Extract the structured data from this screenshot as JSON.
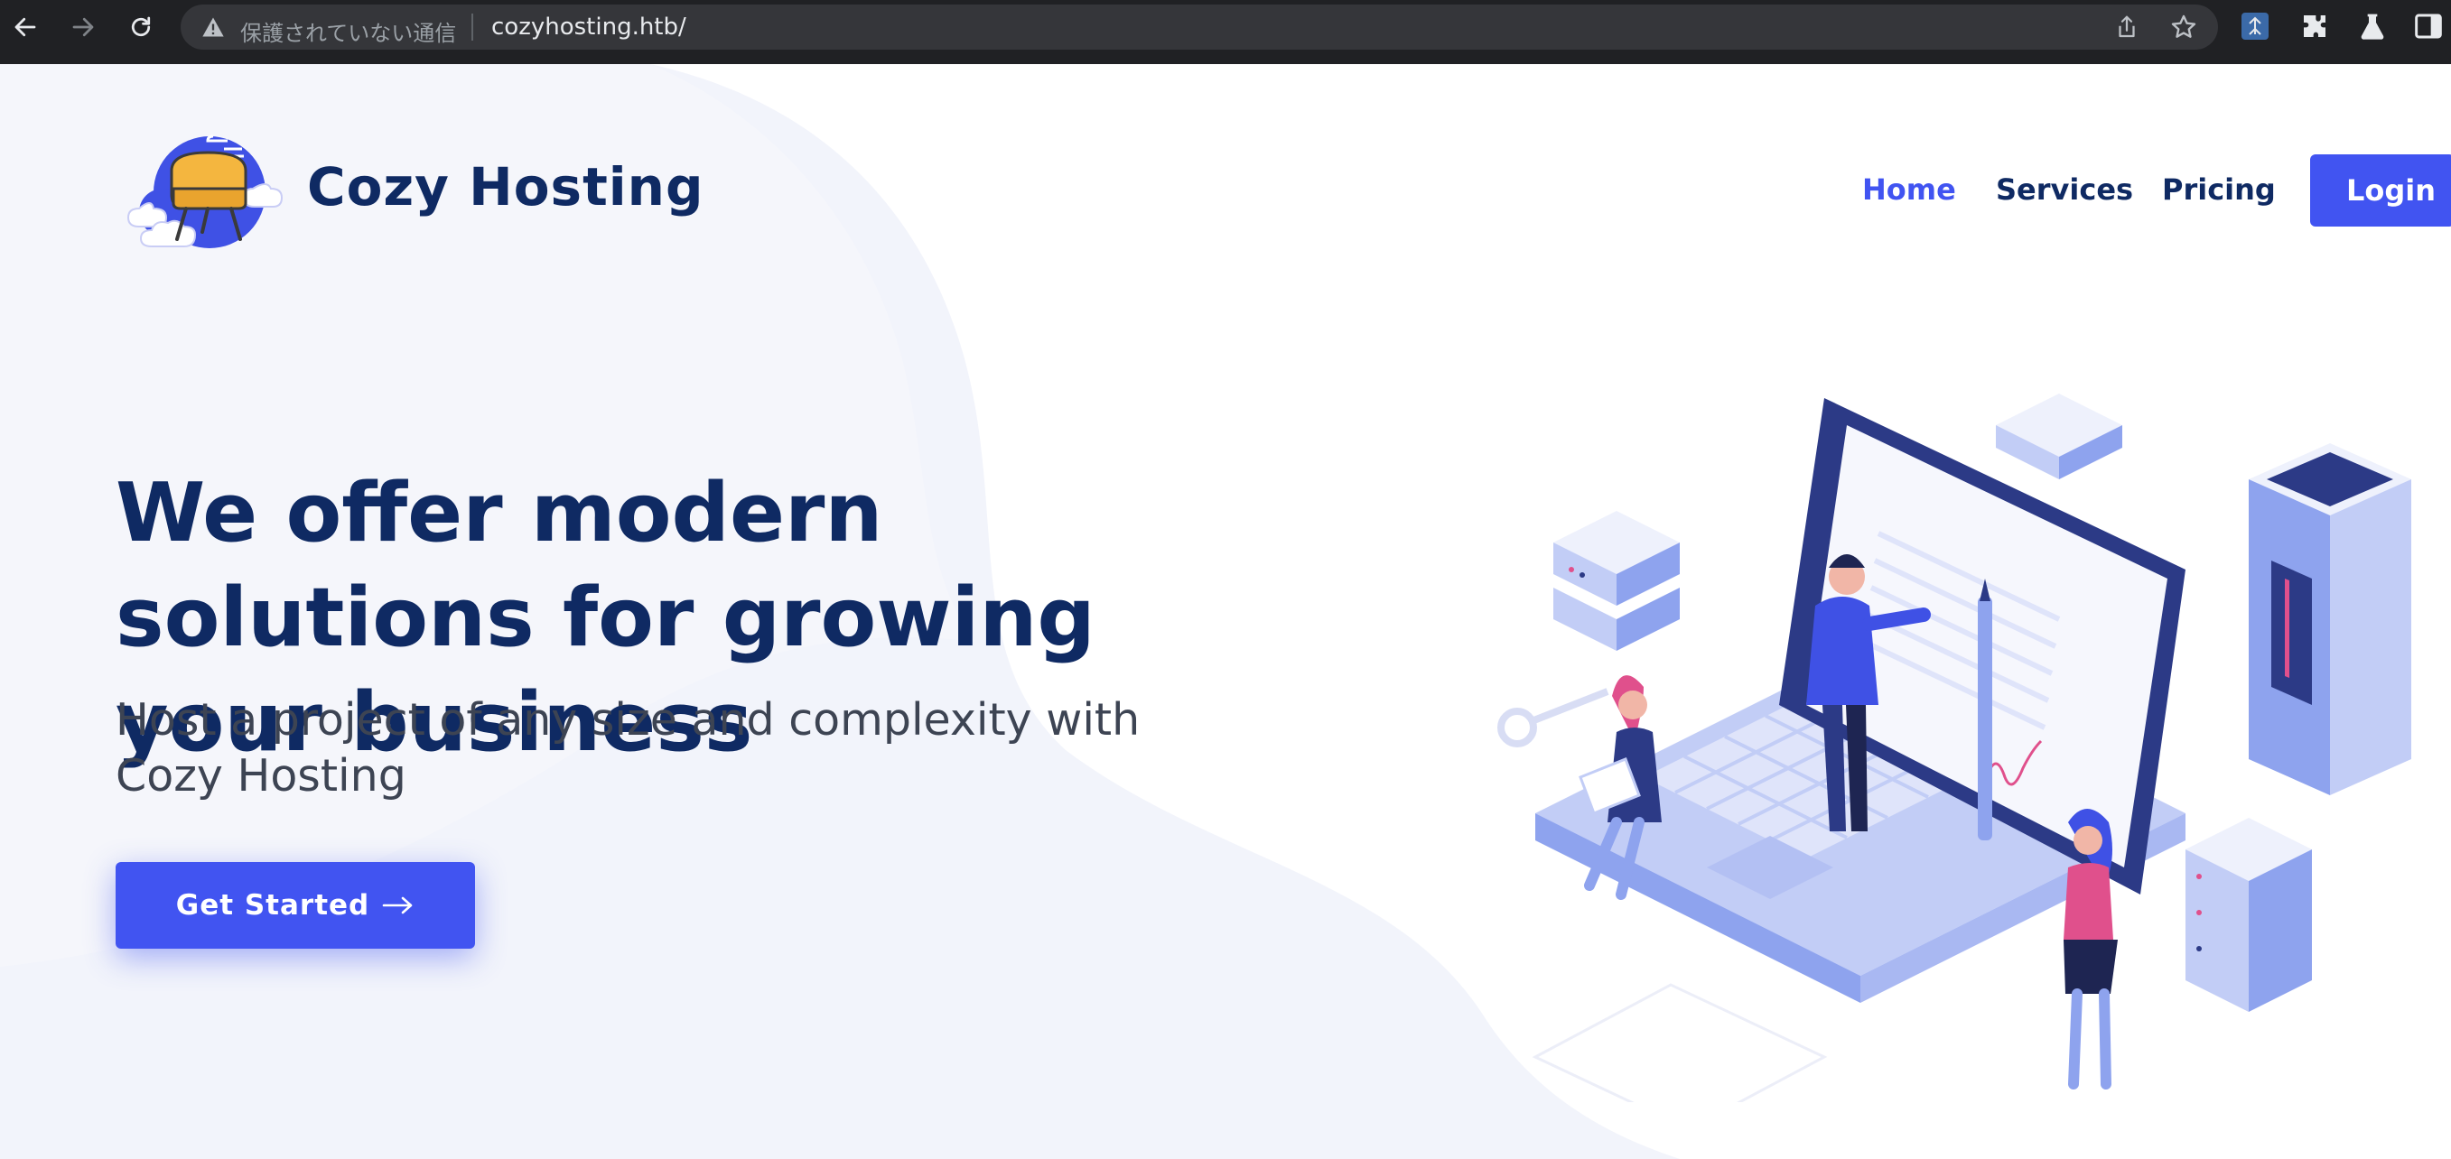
{
  "browser": {
    "security_status": "保護されていない通信",
    "url": "cozyhosting.htb/",
    "icons": [
      "back-arrow-icon",
      "forward-arrow-icon",
      "reload-icon",
      "warning-icon",
      "share-icon",
      "star-icon",
      "extension-profile-icon",
      "puzzle-icon",
      "flask-icon",
      "sidebar-icon"
    ]
  },
  "header": {
    "brand": "Cozy Hosting",
    "nav": {
      "home": "Home",
      "services": "Services",
      "pricing": "Pricing"
    },
    "login_label": "Login"
  },
  "hero": {
    "title": "We offer modern solutions for growing your business",
    "subtitle": "Host a project of any size and complexity with Cozy Hosting",
    "cta_label": "Get Started"
  },
  "colors": {
    "accent": "#4154f1",
    "heading": "#0f2a63",
    "chrome": "#202124"
  }
}
